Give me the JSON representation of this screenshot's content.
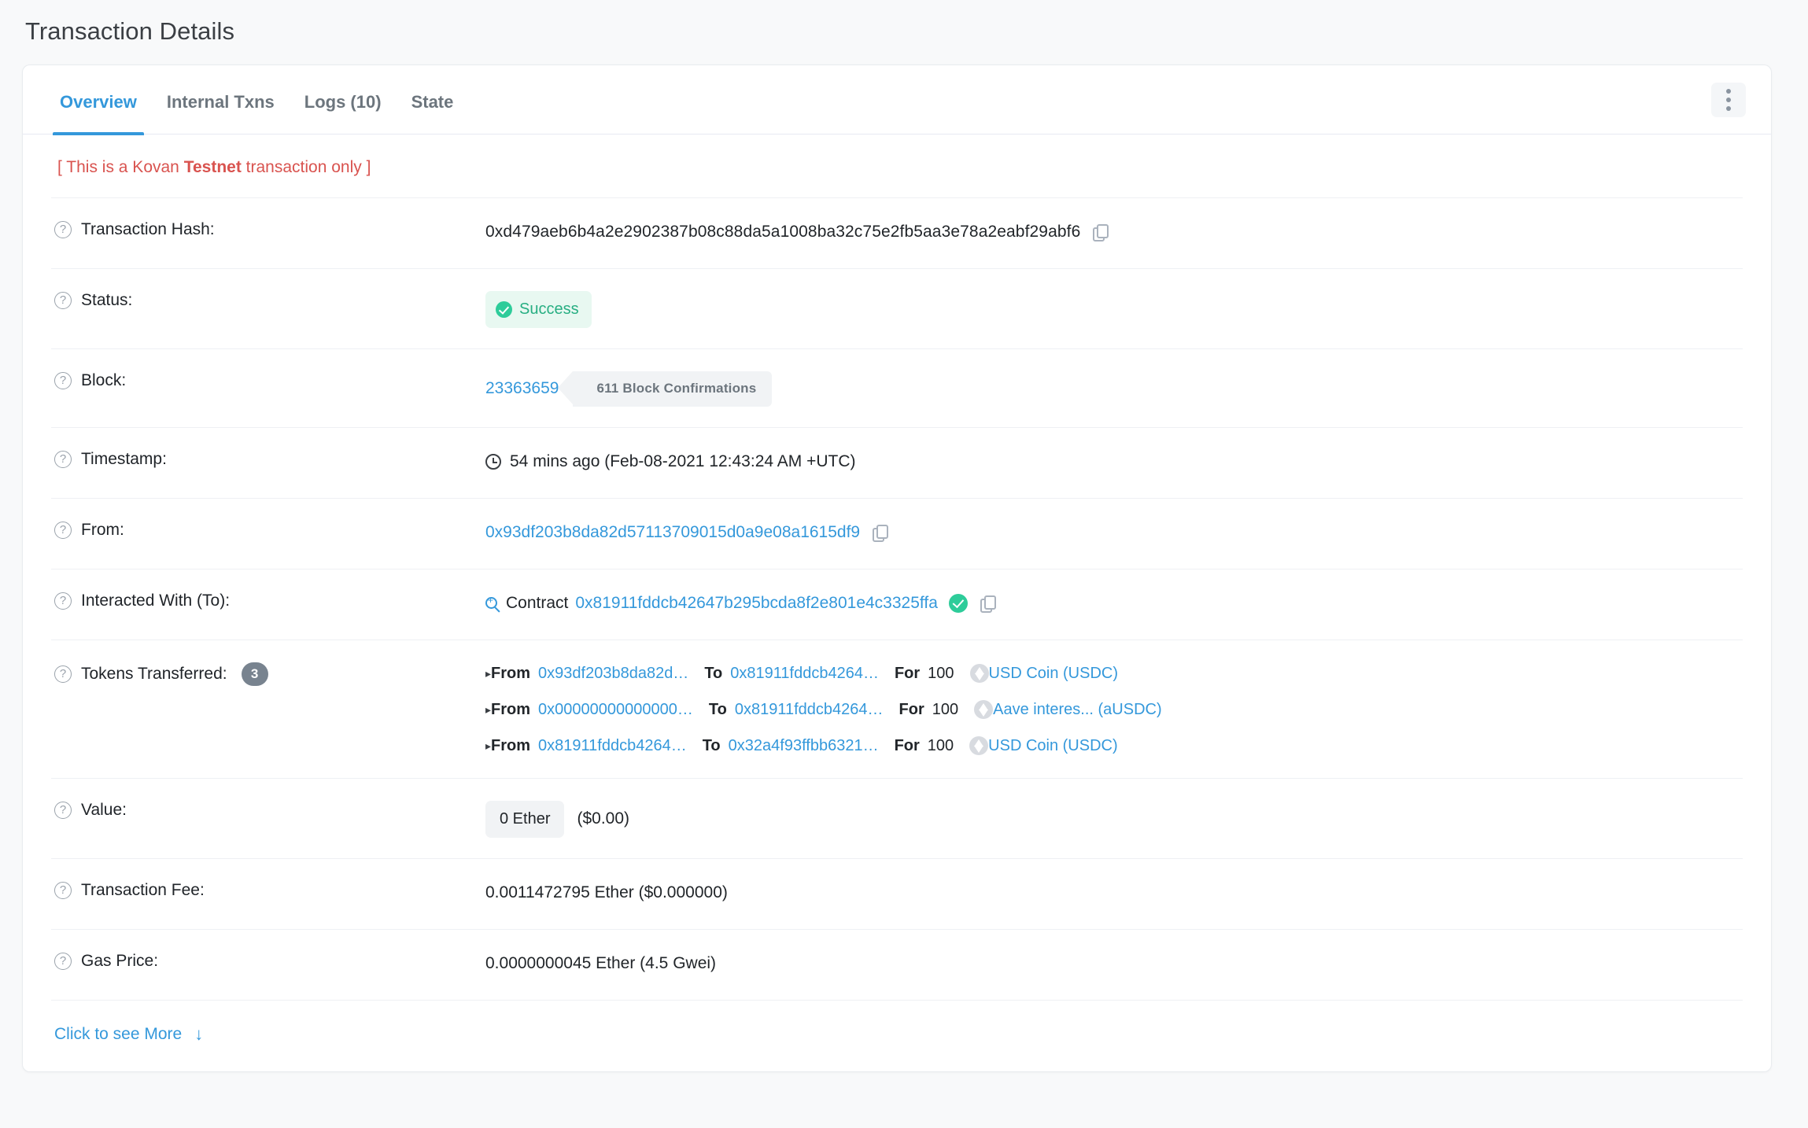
{
  "page": {
    "title": "Transaction Details"
  },
  "tabs": [
    {
      "label": "Overview",
      "active": true
    },
    {
      "label": "Internal Txns",
      "active": false
    },
    {
      "label": "Logs (10)",
      "active": false
    },
    {
      "label": "State",
      "active": false
    }
  ],
  "menu": {
    "kebab_label": ""
  },
  "banner": {
    "prefix": "[ This is a Kovan ",
    "emphasis": "Testnet",
    "suffix": " transaction only ]",
    "color": "#d9534f"
  },
  "fields": {
    "transaction_hash": {
      "label": "Transaction Hash:",
      "value": "0xd479aeb6b4a2e2902387b08c88da5a1008ba32c75e2fb5aa3e78a2eabf29abf6"
    },
    "status": {
      "label": "Status:",
      "value": "Success",
      "color": "#27ae82"
    },
    "block": {
      "label": "Block:",
      "number": "23363659",
      "confirmations": "611 Block Confirmations"
    },
    "timestamp": {
      "label": "Timestamp:",
      "value": "54 mins ago (Feb-08-2021 12:43:24 AM +UTC)"
    },
    "from": {
      "label": "From:",
      "value": "0x93df203b8da82d57113709015d0a9e08a1615df9"
    },
    "interacted_with": {
      "label": "Interacted With (To):",
      "contract_word": "Contract",
      "address": "0x81911fddcb42647b295bcda8f2e801e4c3325ffa"
    },
    "tokens_transferred": {
      "label": "Tokens Transferred:",
      "count": "3",
      "from_word": "From",
      "to_word": "To",
      "for_word": "For",
      "transfers": [
        {
          "from": "0x93df203b8da82d…",
          "to": "0x81911fddcb4264…",
          "amount": "100",
          "token": "USD Coin (USDC)"
        },
        {
          "from": "0x00000000000000…",
          "to": "0x81911fddcb4264…",
          "amount": "100",
          "token": "Aave interes... (aUSDC)"
        },
        {
          "from": "0x81911fddcb4264…",
          "to": "0x32a4f93ffbb6321…",
          "amount": "100",
          "token": "USD Coin (USDC)"
        }
      ]
    },
    "value": {
      "label": "Value:",
      "amount": "0 Ether",
      "fiat": "($0.00)"
    },
    "transaction_fee": {
      "label": "Transaction Fee:",
      "value": "0.0011472795 Ether ($0.000000)"
    },
    "gas_price": {
      "label": "Gas Price:",
      "value": "0.0000000045 Ether (4.5 Gwei)"
    }
  },
  "footer": {
    "see_more_label": "Click to see More",
    "arrow": "↓"
  }
}
